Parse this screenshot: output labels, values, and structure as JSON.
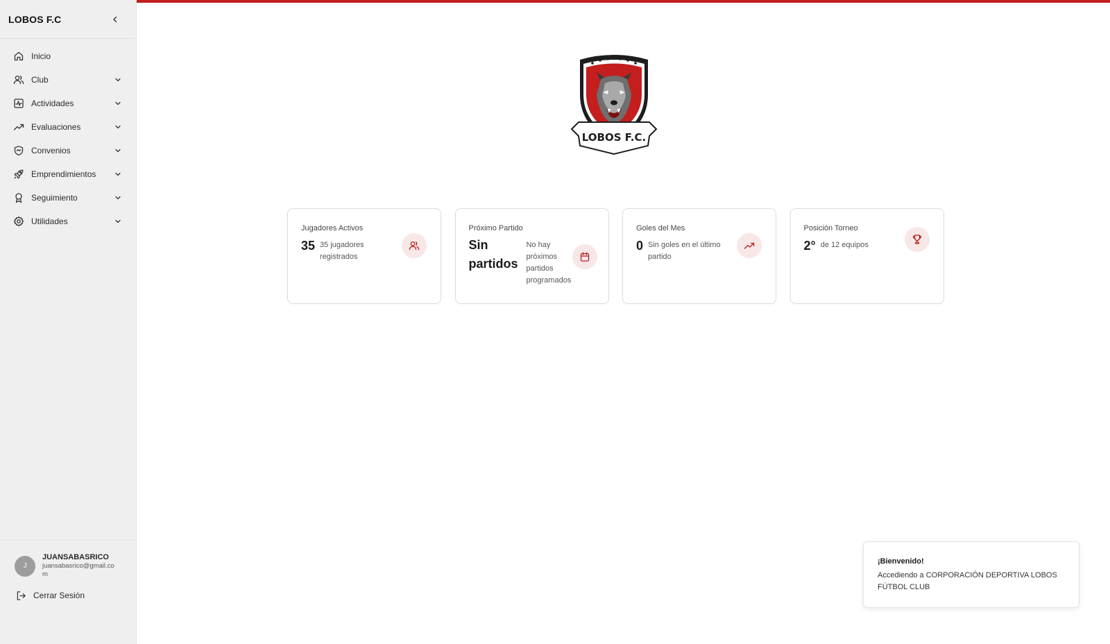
{
  "colors": {
    "accent": "#c0201f",
    "icon_bg": "#f8e7e7",
    "sidebar_bg": "#efefef"
  },
  "sidebar": {
    "brand": "LOBOS F.C",
    "items": [
      {
        "label": "Inicio",
        "icon": "home-icon",
        "expandable": false
      },
      {
        "label": "Club",
        "icon": "users-icon",
        "expandable": true
      },
      {
        "label": "Actividades",
        "icon": "activity-icon",
        "expandable": true
      },
      {
        "label": "Evaluaciones",
        "icon": "trending-up-icon",
        "expandable": true
      },
      {
        "label": "Convenios",
        "icon": "handshake-icon",
        "expandable": true
      },
      {
        "label": "Emprendimientos",
        "icon": "rocket-icon",
        "expandable": true
      },
      {
        "label": "Seguimiento",
        "icon": "award-icon",
        "expandable": true
      },
      {
        "label": "Utilidades",
        "icon": "settings-icon",
        "expandable": true
      }
    ],
    "user": {
      "initial": "J",
      "name": "JUANSABASRICO",
      "email": "juansabasrico@gmail.com"
    },
    "logout_label": "Cerrar Sesión"
  },
  "logo": {
    "text": "LOBOS F.C."
  },
  "cards": [
    {
      "title": "Jugadores Activos",
      "value": "35",
      "desc": "35 jugadores registrados",
      "icon": "users-icon"
    },
    {
      "title": "Próximo Partido",
      "value": "Sin partidos",
      "desc": "No hay próximos partidos programados",
      "icon": "calendar-icon"
    },
    {
      "title": "Goles del Mes",
      "value": "0",
      "desc": "Sin goles en el último partido",
      "icon": "trending-up-icon"
    },
    {
      "title": "Posición Torneo",
      "value": "2°",
      "desc": "de 12 equipos",
      "icon": "trophy-icon"
    }
  ],
  "toast": {
    "title": "¡Bienvenido!",
    "message": "Accediendo a CORPORACIÓN DEPORTIVA LOBOS FÚTBOL CLUB"
  }
}
